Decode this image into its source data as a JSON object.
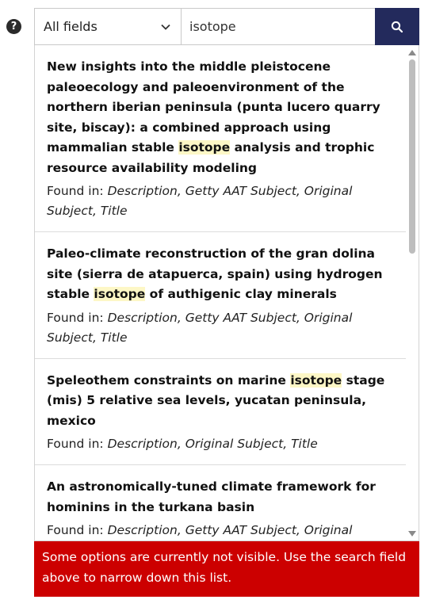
{
  "help": {
    "glyph": "?"
  },
  "search": {
    "field_selected": "All fields",
    "query": "isotope"
  },
  "results": [
    {
      "title_before": "New insights into the middle pleistocene paleoecology and paleoenvironment of the northern iberian peninsula (punta lucero quarry site, biscay): a combined approach using mammalian stable ",
      "title_match": "isotope",
      "title_after": " analysis and trophic resource availability modeling",
      "found_label": "Found in:",
      "found_fields": "Description, Getty AAT Subject, Original Subject, Title"
    },
    {
      "title_before": "Paleo-climate reconstruction of the gran dolina site (sierra de atapuerca, spain) using hydrogen stable ",
      "title_match": "isotope",
      "title_after": " of authigenic clay minerals",
      "found_label": "Found in:",
      "found_fields": "Description, Getty AAT Subject, Original Subject, Title"
    },
    {
      "title_before": "Speleothem constraints on marine ",
      "title_match": "isotope",
      "title_after": " stage (mis) 5 relative sea levels, yucatan peninsula, mexico",
      "found_label": "Found in:",
      "found_fields": "Description, Original Subject, Title"
    },
    {
      "title_before": "An astronomically-tuned climate framework for hominins in the turkana basin",
      "title_match": "",
      "title_after": "",
      "found_label": "Found in:",
      "found_fields": "Description, Getty AAT Subject, Original"
    }
  ],
  "notice": "Some options are currently not visible. Use the search field above to narrow down this list.",
  "colors": {
    "search_button": "#232a5c",
    "highlight": "#fdf7c6",
    "notice_bg": "#cc0000"
  }
}
